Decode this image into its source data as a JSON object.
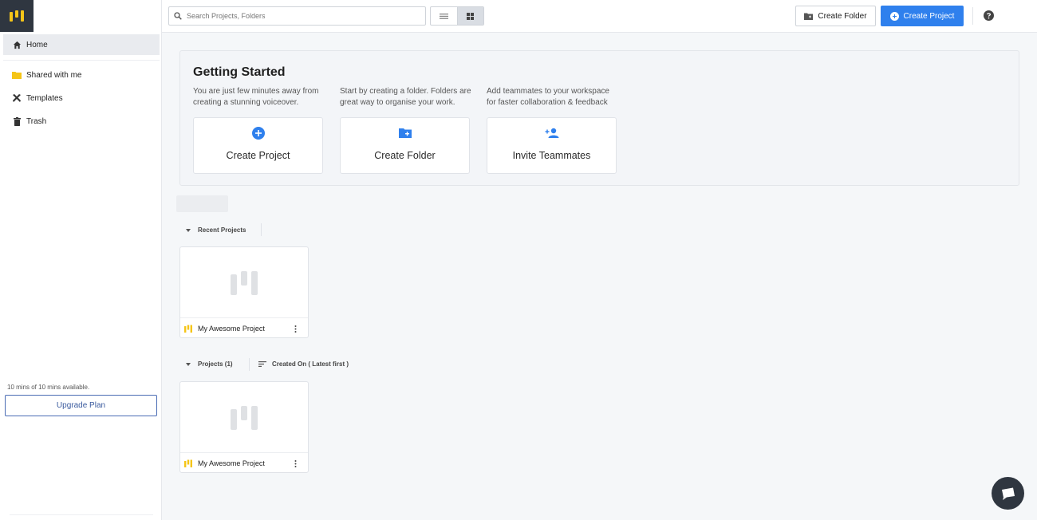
{
  "sidebar": {
    "items": [
      {
        "label": "Home",
        "icon": "home-icon"
      },
      {
        "label": "Shared with me",
        "icon": "shared-folder-icon"
      },
      {
        "label": "Templates",
        "icon": "templates-icon"
      },
      {
        "label": "Trash",
        "icon": "trash-icon"
      }
    ],
    "mins_available": "10 mins of 10 mins available.",
    "upgrade_label": "Upgrade Plan"
  },
  "topbar": {
    "search_placeholder": "Search Projects, Folders",
    "create_folder_label": "Create Folder",
    "create_project_label": "Create Project"
  },
  "getting_started": {
    "title": "Getting Started",
    "columns": [
      {
        "desc": "You are just few minutes away from creating a stunning voiceover.",
        "card_label": "Create Project",
        "icon": "plus-circle-icon"
      },
      {
        "desc": "Start by creating a folder. Folders are great way to organise your work.",
        "card_label": "Create Folder",
        "icon": "add-folder-icon"
      },
      {
        "desc": "Add teammates to your workspace for faster collaboration & feedback",
        "card_label": "Invite Teammates",
        "icon": "add-person-icon"
      }
    ]
  },
  "recent": {
    "heading": "Recent Projects",
    "projects": [
      {
        "name": "My Awesome Project"
      }
    ]
  },
  "projects": {
    "heading": "Projects (1)",
    "sort_label": "Created On ( Latest first )",
    "items": [
      {
        "name": "My Awesome Project"
      }
    ]
  },
  "colors": {
    "accent": "#2f80ed",
    "brand_yellow": "#f5c518",
    "dark": "#2f3640"
  }
}
